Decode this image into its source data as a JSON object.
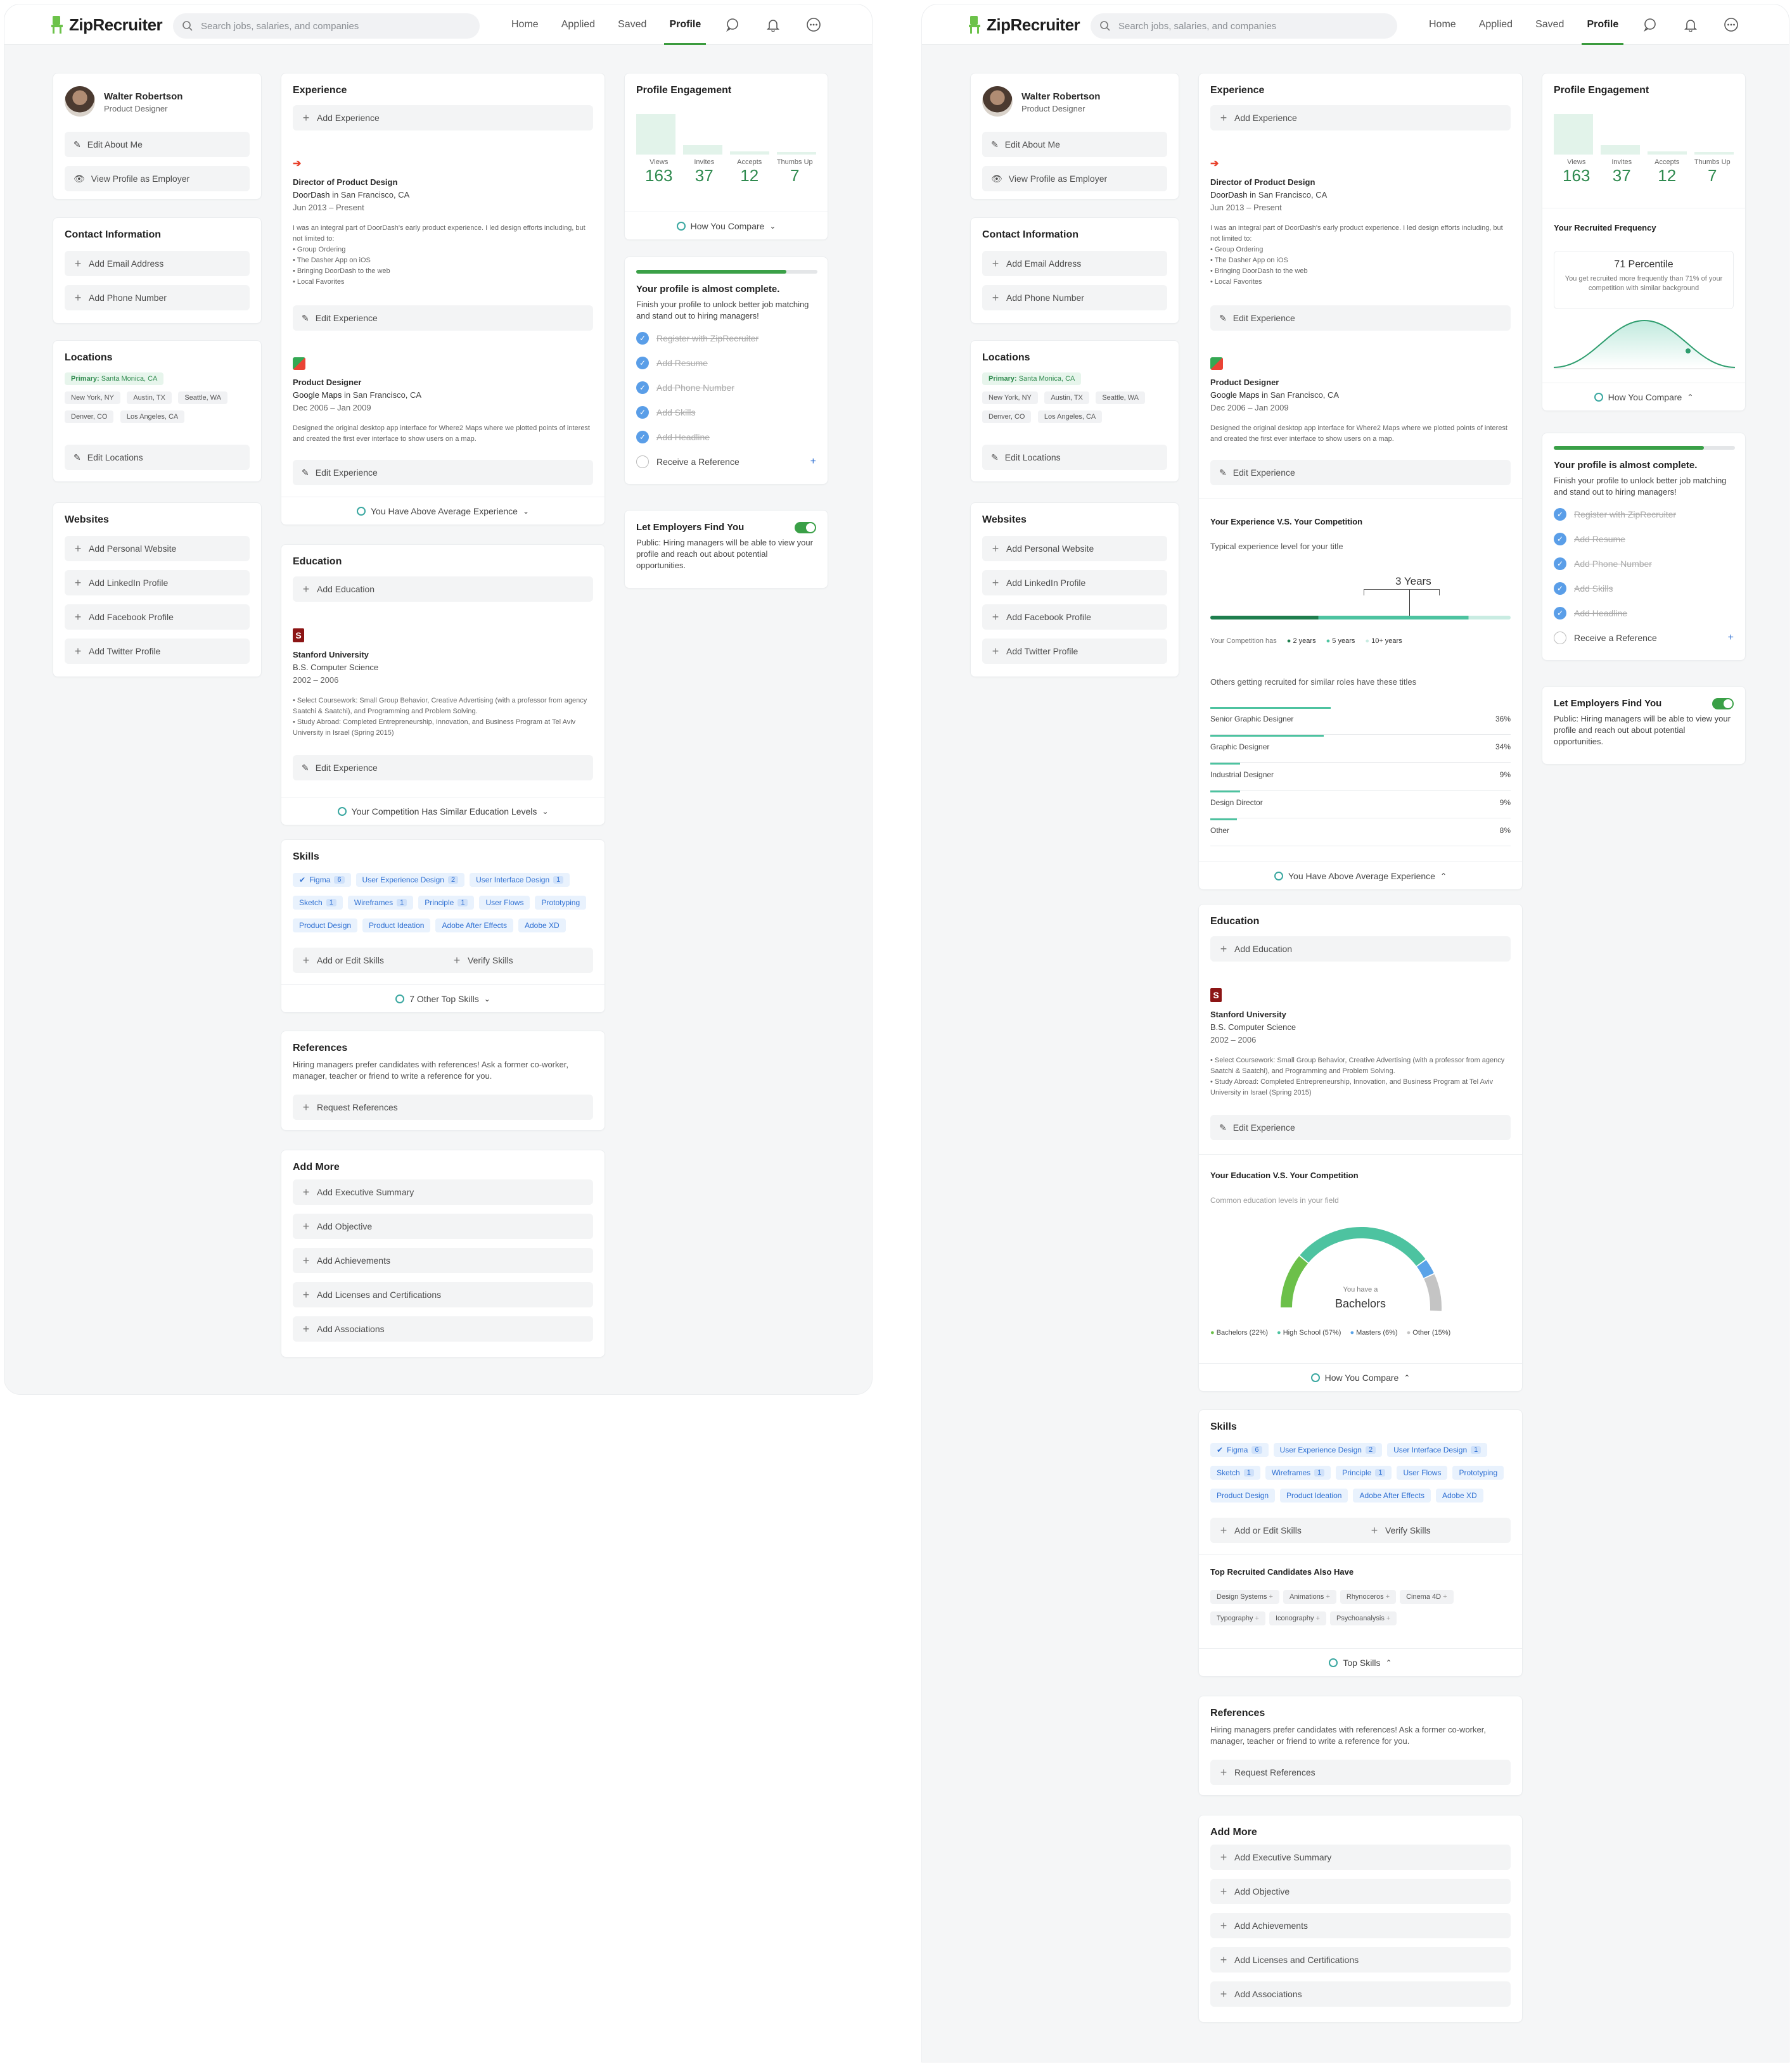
{
  "brand": {
    "name": "ZipRecruiter",
    "accent": "#3b9b3e",
    "link": "#2e6fd2"
  },
  "search": {
    "placeholder": "Search jobs, salaries, and companies"
  },
  "nav": {
    "home": "Home",
    "applied": "Applied",
    "saved": "Saved",
    "profile": "Profile"
  },
  "profile": {
    "name": "Walter Robertson",
    "title": "Product Designer",
    "edit_about": "Edit About Me",
    "view_as_employer": "View Profile as Employer"
  },
  "contact": {
    "title": "Contact Information",
    "add_email": "Add Email Address",
    "add_phone": "Add Phone Number"
  },
  "locations": {
    "title": "Locations",
    "primary_label": "Primary:",
    "primary": "Santa Monica, CA",
    "others": [
      "New York, NY",
      "Austin, TX",
      "Seattle, WA",
      "Denver, CO",
      "Los Angeles, CA"
    ],
    "edit": "Edit Locations"
  },
  "websites": {
    "title": "Websites",
    "items": [
      "Add Personal Website",
      "Add LinkedIn Profile",
      "Add Facebook Profile",
      "Add Twitter Profile"
    ]
  },
  "experience": {
    "title": "Experience",
    "add": "Add Experience",
    "edit": "Edit Experience",
    "in": "in",
    "jobs": [
      {
        "role": "Director of Product Design",
        "company": "DoorDash",
        "location": "San Francisco, CA",
        "dates": "Jun 2013 – Present",
        "desc": "I was an integral part of DoorDash's early product experience. I led design efforts including, but not limited to:",
        "bullets": [
          "• Group Ordering",
          "• The Dasher App on iOS",
          "• Bringing DoorDash to the web",
          "• Local Favorites"
        ]
      },
      {
        "role": "Product Designer",
        "company": "Google Maps",
        "location": "San Francisco, CA",
        "dates": "Dec 2006 – Jan 2009",
        "desc": "Designed the original desktop app interface for Where2 Maps where we plotted points of interest and created the first ever interface to show users on a map."
      }
    ],
    "compare_collapsed": "You Have Above Average Experience",
    "compare_title": "Your Experience V.S. Your Competition",
    "compare_sub": "Typical experience level for your title",
    "years_label": "3 Years",
    "legend_prefix": "Your Competition has",
    "legend": [
      "2 years",
      "5 years",
      "10+ years"
    ],
    "titles_heading": "Others getting recruited for similar roles have these titles",
    "titles": [
      {
        "name": "Senior Graphic Designer",
        "pct": "36%",
        "value": 36
      },
      {
        "name": "Graphic Designer",
        "pct": "34%",
        "value": 34
      },
      {
        "name": "Industrial Designer",
        "pct": "9%",
        "value": 9
      },
      {
        "name": "Design Director",
        "pct": "9%",
        "value": 9
      },
      {
        "name": "Other",
        "pct": "8%",
        "value": 8
      }
    ]
  },
  "education": {
    "title": "Education",
    "add": "Add Education",
    "edit": "Edit Experience",
    "school": "Stanford University",
    "degree": "B.S. Computer Science",
    "dates": "2002 – 2006",
    "notes": [
      "• Select Coursework: Small Group Behavior, Creative Advertising (with a professor from agency Saatchi & Saatchi), and Programming and Problem Solving.",
      "• Study Abroad: Completed Entrepreneurship, Innovation, and Business Program at Tel Aviv University in Israel (Spring 2015)"
    ],
    "compare_collapsed": "Your Competition Has Similar Education Levels",
    "compare_title": "Your Education V.S. Your Competition",
    "compare_sub": "Common education levels in your field",
    "gauge_small": "You have a",
    "gauge_big": "Bachelors",
    "gauge_legend": [
      {
        "label": "Bachelors (22%)",
        "color": "#6cc04a",
        "value": 22
      },
      {
        "label": "High School (57%)",
        "color": "#4dc3a0",
        "value": 57
      },
      {
        "label": "Masters (6%)",
        "color": "#5aa3e8",
        "value": 6
      },
      {
        "label": "Other (15%)",
        "color": "#c4c4c4",
        "value": 15
      }
    ],
    "how_compare": "How You Compare"
  },
  "skills": {
    "title": "Skills",
    "items": [
      {
        "name": "Figma",
        "count": "6",
        "verified": true
      },
      {
        "name": "User Experience Design",
        "count": "2"
      },
      {
        "name": "User Interface Design",
        "count": "1"
      },
      {
        "name": "Sketch",
        "count": "1"
      },
      {
        "name": "Wireframes",
        "count": "1"
      },
      {
        "name": "Principle",
        "count": "1"
      },
      {
        "name": "User Flows",
        "count": ""
      },
      {
        "name": "Prototyping",
        "count": ""
      },
      {
        "name": "Product Design",
        "count": ""
      },
      {
        "name": "Product Ideation",
        "count": ""
      },
      {
        "name": "Adobe After Effects",
        "count": ""
      },
      {
        "name": "Adobe XD",
        "count": ""
      }
    ],
    "add_edit": "Add or Edit Skills",
    "verify": "Verify Skills",
    "other_top": "7 Other Top Skills",
    "top_heading": "Top Recruited Candidates Also Have",
    "top_items": [
      "Design Systems",
      "Animations",
      "Rhynoceros",
      "Cinema 4D",
      "Typography",
      "Iconography",
      "Psychoanalysis"
    ],
    "top_skills": "Top Skills"
  },
  "references": {
    "title": "References",
    "desc": "Hiring managers prefer candidates with references! Ask a former co-worker, manager, teacher or friend to write a reference for you.",
    "request": "Request References"
  },
  "add_more": {
    "title": "Add More",
    "items": [
      "Add Executive Summary",
      "Add Objective",
      "Add Achievements",
      "Add Licenses and Certifications",
      "Add Associations"
    ]
  },
  "engagement": {
    "title": "Profile Engagement",
    "stats": [
      {
        "label": "Views",
        "value": "163",
        "n": 163
      },
      {
        "label": "Invites",
        "value": "37",
        "n": 37
      },
      {
        "label": "Accepts",
        "value": "12",
        "n": 12
      },
      {
        "label": "Thumbs Up",
        "value": "7",
        "n": 7
      }
    ],
    "how_compare": "How You Compare",
    "frequency_title": "Your Recruited Frequency",
    "percentile": "71 Percentile",
    "percentile_desc": "You get recruited more frequently than 71% of your competition with similar background"
  },
  "completion": {
    "title": "Your profile is almost complete.",
    "desc": "Finish your profile to unlock better job matching and stand out to hiring managers!",
    "progress": 0.83,
    "done": [
      "Register with ZipRecruiter",
      "Add Resume",
      "Add Phone Number",
      "Add Skills",
      "Add Headline"
    ],
    "todo": "Receive a Reference"
  },
  "visibility": {
    "title": "Let Employers Find You",
    "desc": "Public: Hiring managers will be able to view your profile and reach out about potential opportunities.",
    "enabled": true
  }
}
